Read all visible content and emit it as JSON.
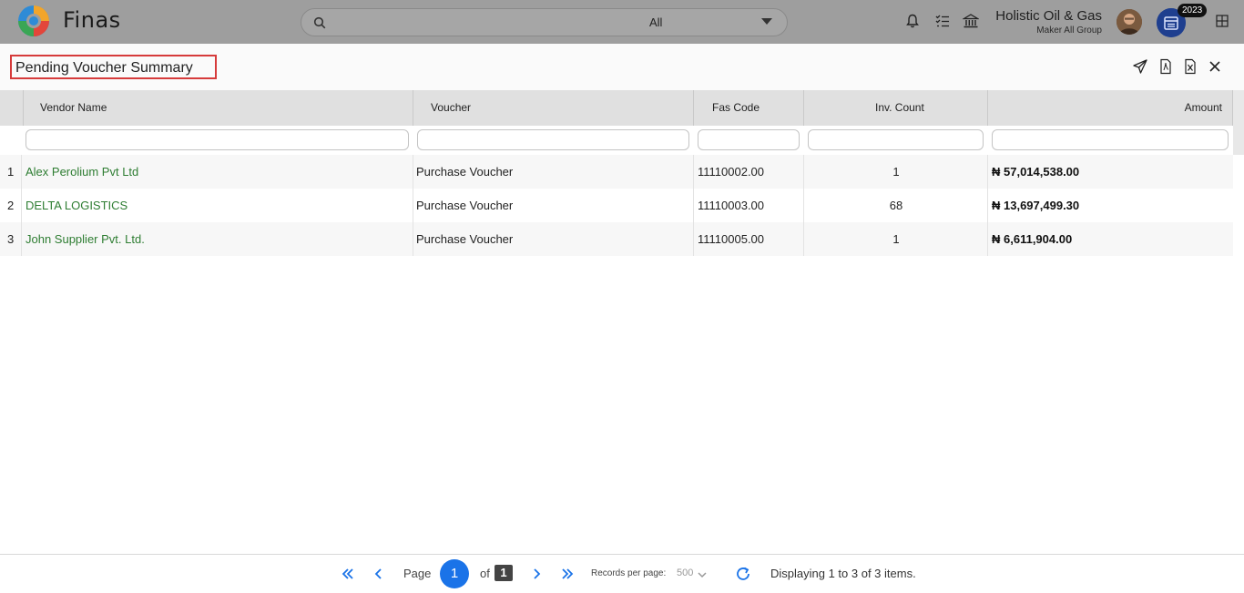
{
  "app": {
    "name": "Finas"
  },
  "search": {
    "placeholder": "",
    "scope": "All"
  },
  "company": {
    "name": "Holistic Oil & Gas",
    "role": "Maker All Group"
  },
  "year_badge": "2023",
  "page": {
    "title": "Pending Voucher Summary"
  },
  "toolbar_icons": [
    "send-icon",
    "pdf-icon",
    "excel-icon",
    "close-icon"
  ],
  "table": {
    "columns": [
      "Vendor Name",
      "Voucher",
      "Fas Code",
      "Inv. Count",
      "Amount"
    ],
    "rows": [
      {
        "num": "1",
        "vendor": "Alex Perolium Pvt Ltd",
        "voucher": "Purchase Voucher",
        "fas_code": "11110002.00",
        "inv_count": "1",
        "amount": "₦ 57,014,538.00"
      },
      {
        "num": "2",
        "vendor": "DELTA LOGISTICS",
        "voucher": "Purchase Voucher",
        "fas_code": "11110003.00",
        "inv_count": "68",
        "amount": "₦ 13,697,499.30"
      },
      {
        "num": "3",
        "vendor": "John Supplier Pvt. Ltd.",
        "voucher": "Purchase Voucher",
        "fas_code": "11110005.00",
        "inv_count": "1",
        "amount": "₦ 6,611,904.00"
      }
    ]
  },
  "pager": {
    "page_label": "Page",
    "current_page": "1",
    "of_label": "of",
    "total_pages": "1",
    "records_label": "Records per page:",
    "records_per_page": "500",
    "info": "Displaying 1 to 3 of 3 items."
  },
  "colors": {
    "accent": "#1a73e8",
    "vendor_link": "#2e7d32",
    "topbar": "#9e9e9e",
    "title_border": "#d63b3b"
  }
}
